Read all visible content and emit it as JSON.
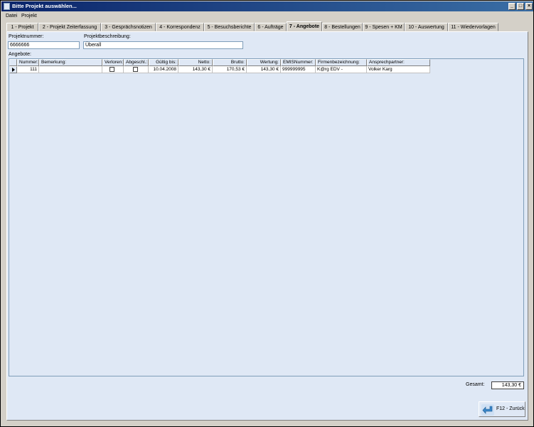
{
  "window": {
    "title": "Bitte Projekt auswählen..."
  },
  "menu": [
    "Datei",
    "Projekt"
  ],
  "tabs": [
    {
      "label": "1 - Projekt"
    },
    {
      "label": "2 - Projekt Zeiterfassung"
    },
    {
      "label": "3 - Gesprächsnotizen"
    },
    {
      "label": "4 - Korrespondenz"
    },
    {
      "label": "5 - Besuchsberichte"
    },
    {
      "label": "6 - Aufträge"
    },
    {
      "label": "7 - Angebote",
      "active": true
    },
    {
      "label": "8 - Bestellungen"
    },
    {
      "label": "9 - Spesen + KM"
    },
    {
      "label": "10 - Auswertung"
    },
    {
      "label": "11 - Wiedervorlagen"
    }
  ],
  "project": {
    "nummer_label": "Projektnummer:",
    "nummer_value": "6666666",
    "beschreibung_label": "Projektbeschreibung:",
    "beschreibung_value": "Überall"
  },
  "offers": {
    "label": "Angebote:",
    "columns": [
      "Nummer:",
      "Bemerkung:",
      "Verloren:",
      "Abgeschl.:",
      "Gültig bis:",
      "Netto:",
      "Brutto:",
      "Wertung:",
      "EMISNummer:",
      "Firmenbezeichnung:",
      "Ansprechpartner:"
    ],
    "rows": [
      {
        "nummer": "111",
        "bemerkung": "",
        "verloren": false,
        "abgeschl": false,
        "gueltig": "10.04.2008",
        "netto": "143,30 €",
        "brutto": "170,53 €",
        "wertung": "143,30 €",
        "emis": "999999995",
        "firma": "K@rg EDV -",
        "ansprech": "Volker Karg"
      }
    ]
  },
  "footer": {
    "gesamt_label": "Gesamt:",
    "gesamt_value": "143,30 €",
    "back_label": "F12 - Zurück"
  }
}
